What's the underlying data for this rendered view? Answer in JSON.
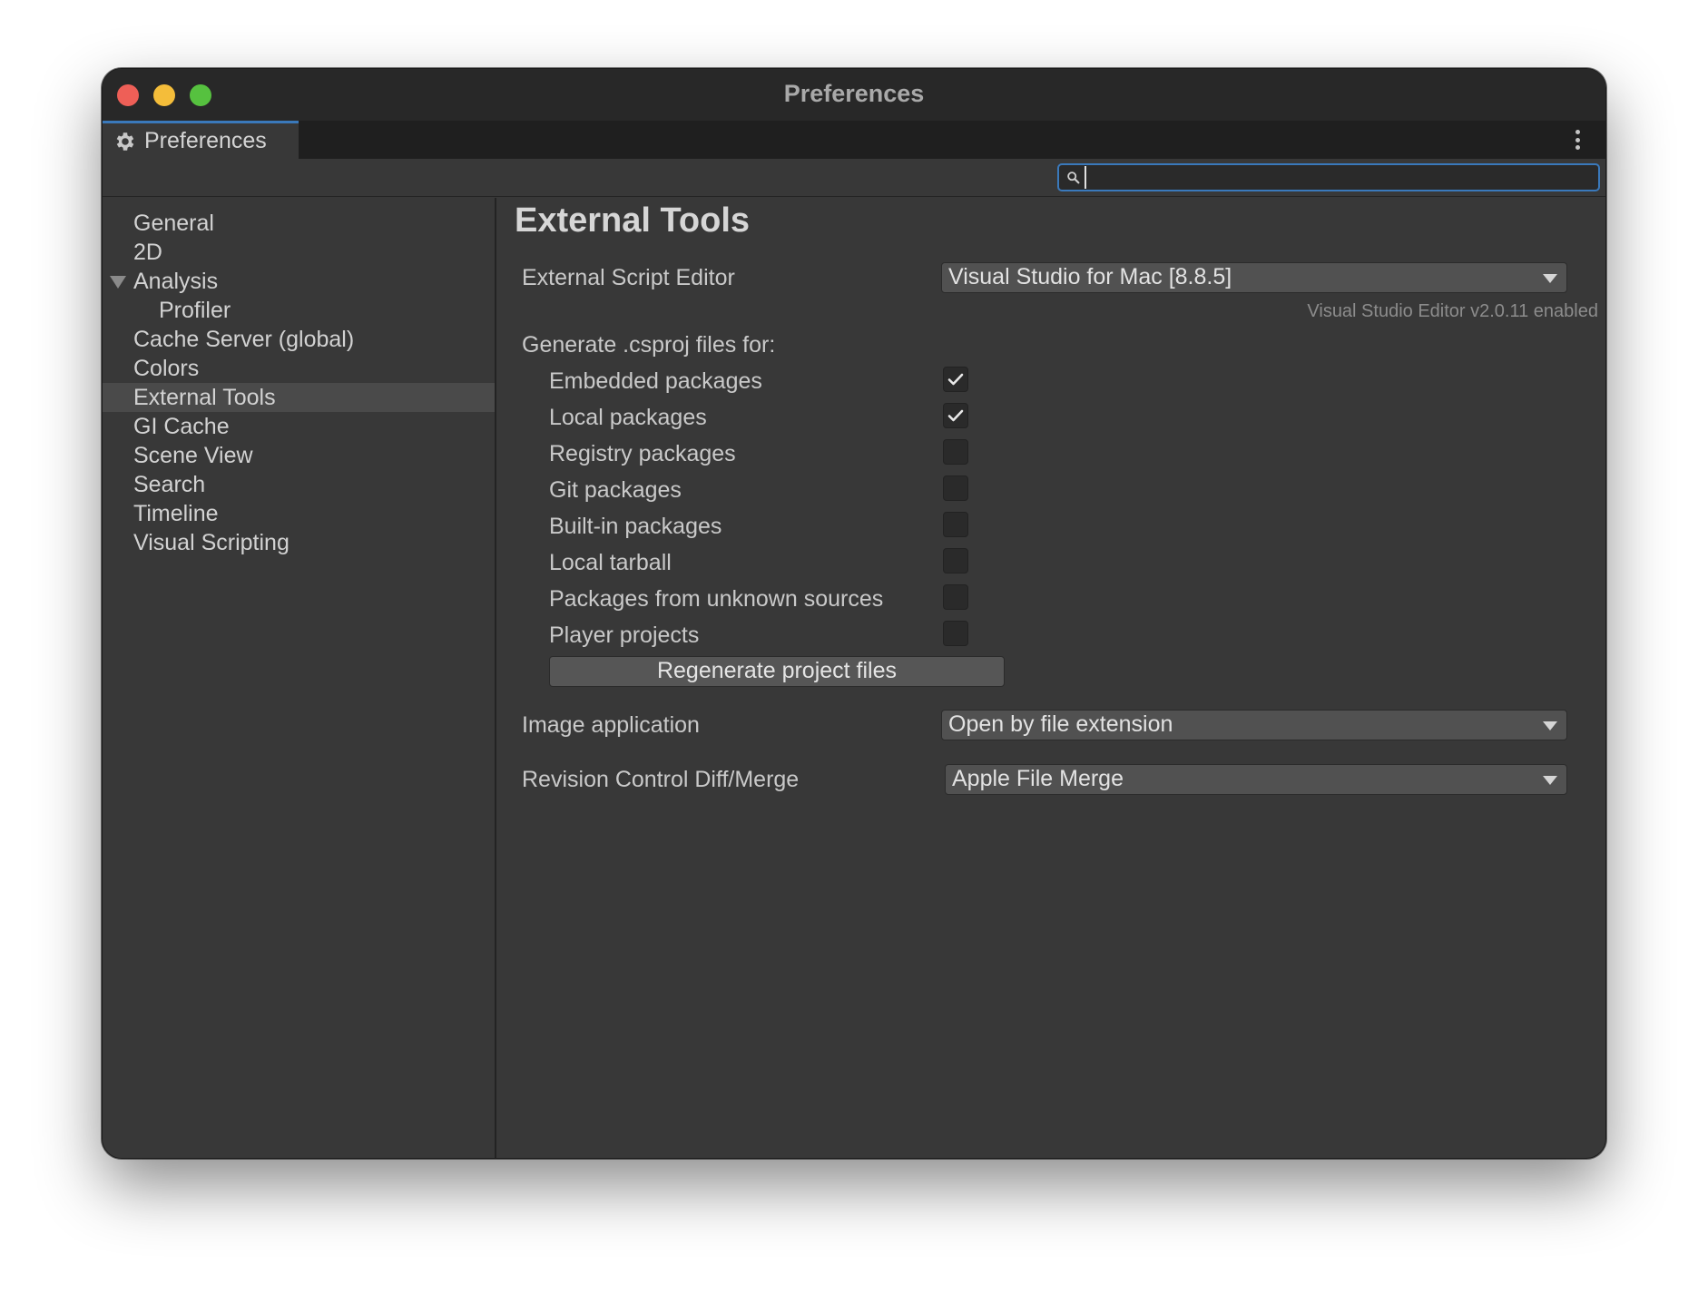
{
  "window": {
    "title": "Preferences"
  },
  "tab": {
    "label": "Preferences"
  },
  "search": {
    "value": "",
    "placeholder": ""
  },
  "sidebar": {
    "items": [
      {
        "label": "General"
      },
      {
        "label": "2D"
      },
      {
        "label": "Analysis"
      },
      {
        "label": "Profiler"
      },
      {
        "label": "Cache Server (global)"
      },
      {
        "label": "Colors"
      },
      {
        "label": "External Tools"
      },
      {
        "label": "GI Cache"
      },
      {
        "label": "Scene View"
      },
      {
        "label": "Search"
      },
      {
        "label": "Timeline"
      },
      {
        "label": "Visual Scripting"
      }
    ],
    "selected": "External Tools"
  },
  "main": {
    "heading": "External Tools",
    "script_editor": {
      "label": "External Script Editor",
      "value": "Visual Studio for Mac [8.8.5]",
      "note": "Visual Studio Editor v2.0.11 enabled"
    },
    "generate_label": "Generate .csproj files for:",
    "options": [
      {
        "label": "Embedded packages",
        "checked": true
      },
      {
        "label": "Local packages",
        "checked": true
      },
      {
        "label": "Registry packages",
        "checked": false
      },
      {
        "label": "Git packages",
        "checked": false
      },
      {
        "label": "Built-in packages",
        "checked": false
      },
      {
        "label": "Local tarball",
        "checked": false
      },
      {
        "label": "Packages from unknown sources",
        "checked": false
      },
      {
        "label": "Player projects",
        "checked": false
      }
    ],
    "regenerate_label": "Regenerate project files",
    "image_app": {
      "label": "Image application",
      "value": "Open by file extension"
    },
    "diff_merge": {
      "label": "Revision Control Diff/Merge",
      "value": "Apple File Merge"
    }
  },
  "colors": {
    "accent": "#3a79bb",
    "close": "#ee5f57",
    "minimize": "#f4bd3a",
    "maximize": "#56c13f"
  }
}
